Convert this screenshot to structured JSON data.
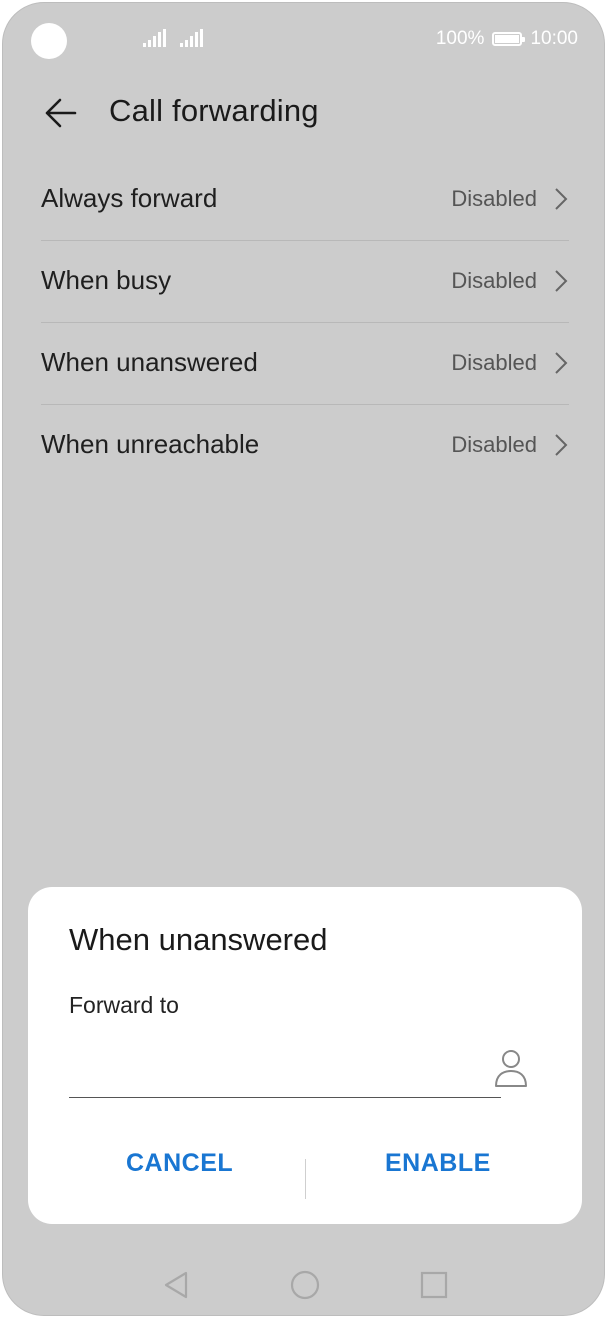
{
  "status_bar": {
    "battery_percent": "100%",
    "time": "10:00",
    "icons": [
      "camera-cutout",
      "signal-icon",
      "signal-icon",
      "battery-icon"
    ]
  },
  "header": {
    "title": "Call forwarding",
    "back_icon": "back-arrow-icon"
  },
  "list": {
    "items": [
      {
        "label": "Always forward",
        "status": "Disabled"
      },
      {
        "label": "When busy",
        "status": "Disabled"
      },
      {
        "label": "When unanswered",
        "status": "Disabled"
      },
      {
        "label": "When unreachable",
        "status": "Disabled"
      }
    ]
  },
  "dialog": {
    "title": "When unanswered",
    "field_label": "Forward to",
    "input_value": "",
    "contact_icon": "contact-icon",
    "cancel_label": "CANCEL",
    "enable_label": "ENABLE"
  },
  "navbar": {
    "icons": [
      "back-triangle-icon",
      "home-circle-icon",
      "recents-square-icon"
    ]
  },
  "colors": {
    "background_dim": "#cccccc",
    "accent": "#1976d2",
    "dialog_bg": "#ffffff"
  }
}
